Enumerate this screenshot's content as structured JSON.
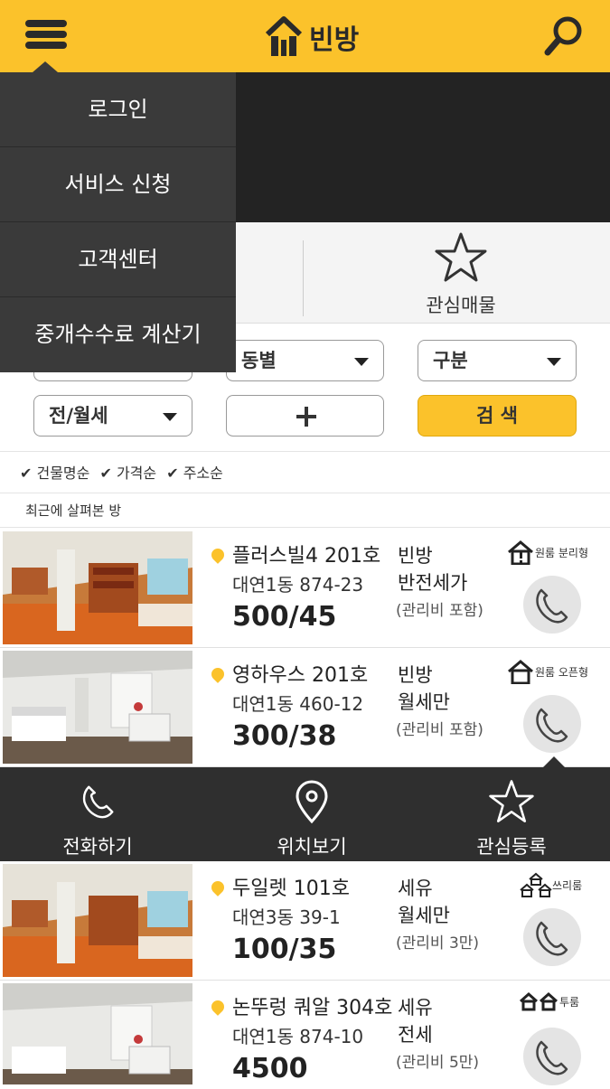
{
  "header": {
    "logo_text": "빈방",
    "menu_icon": "hamburger-icon",
    "search_icon": "search-icon",
    "brand_color": "#fbc22b"
  },
  "menu": {
    "items": [
      {
        "label": "로그인"
      },
      {
        "label": "서비스 신청"
      },
      {
        "label": "고객센터"
      },
      {
        "label": "중개수수료 계산기"
      }
    ]
  },
  "tabs": {
    "favorites_label": "관심매물",
    "favorites_icon": "star-icon"
  },
  "filters": {
    "dong_label": "동별",
    "category_label": "구분",
    "lease_label": "전/월세",
    "search_label": "검 색"
  },
  "sort": {
    "items": [
      "✔ 건물명순",
      "✔ 가격순",
      "✔ 주소순"
    ]
  },
  "recent_label": "최근에 살펴본 방",
  "listings": [
    {
      "name": "플러스빌4 201호",
      "address": "대연1동 874-23",
      "price": "500/45",
      "type1": "빈방",
      "type2": "반전세가",
      "fee": "(관리비 포함)",
      "room_type": "원룸 분리형",
      "room_icon": "house-split-icon"
    },
    {
      "name": "영하우스 201호",
      "address": "대연1동 460-12",
      "price": "300/38",
      "type1": "빈방",
      "type2": "월세만",
      "fee": "(관리비 포함)",
      "room_type": "원룸 오픈형",
      "room_icon": "house-open-icon"
    },
    {
      "name": "두일렛 101호",
      "address": "대연3동 39-1",
      "price": "100/35",
      "type1": "세유",
      "type2": "월세만",
      "fee": "(관리비 3만)",
      "room_type": "쓰리룸",
      "room_icon": "three-house-icon"
    },
    {
      "name": "논뚜렁 쿼알 304호",
      "address": "대연1동 874-10",
      "price": "4500",
      "type1": "세유",
      "type2": "전세",
      "fee": "(관리비 5만)",
      "room_type": "투룸",
      "room_icon": "two-house-icon"
    }
  ],
  "actions": {
    "call_label": "전화하기",
    "location_label": "위치보기",
    "favorite_label": "관심등록"
  }
}
